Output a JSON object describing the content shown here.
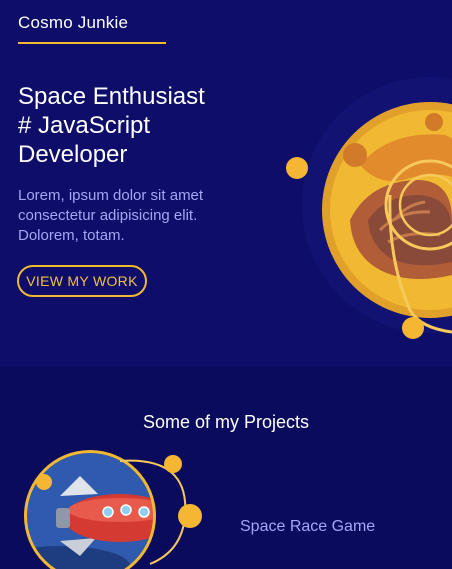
{
  "header": {
    "brand": "Cosmo Junkie"
  },
  "hero": {
    "headline_lines": [
      "Space Enthusiast",
      "# JavaScript",
      "Developer"
    ],
    "intro": "Lorem, ipsum dolor sit amet consectetur adipisicing elit. Dolorem, totam.",
    "cta_label": "VIEW MY WORK"
  },
  "projects": {
    "section_title": "Some of my Projects",
    "items": [
      {
        "name": "Space Race Game"
      }
    ]
  },
  "colors": {
    "background": "#0b0b5e",
    "hero_background": "#0e0e6a",
    "accent": "#f2b830",
    "text_muted": "#a7a4f2",
    "text_primary": "#ffffff"
  },
  "icons": [
    "planet-illustration",
    "rocket-illustration"
  ]
}
